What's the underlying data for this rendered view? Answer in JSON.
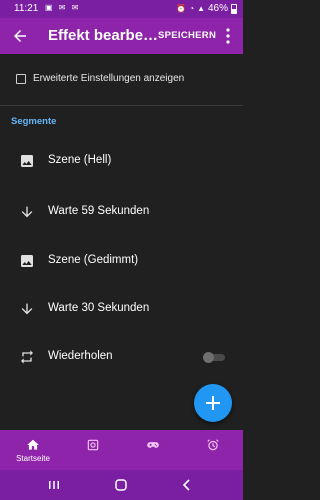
{
  "status_bar": {
    "time": "11:21",
    "left_icons": [
      "gallery-icon",
      "notification-icon",
      "notification-icon"
    ],
    "battery_percent": "46%"
  },
  "app_bar": {
    "title": "Effekt bearbe…",
    "save_label": "SPEICHERN"
  },
  "settings": {
    "advanced_label": "Erweiterte Einstellungen anzeigen",
    "advanced_checked": false
  },
  "segments_header": "Segmente",
  "segments": [
    {
      "icon": "image-icon",
      "label": "Szene (Hell)"
    },
    {
      "icon": "arrow-down-icon",
      "label": "Warte 59 Sekunden"
    },
    {
      "icon": "image-icon",
      "label": "Szene (Gedimmt)"
    },
    {
      "icon": "arrow-down-icon",
      "label": "Warte 30 Sekunden"
    },
    {
      "icon": "repeat-icon",
      "label": "Wiederholen",
      "toggle": false
    }
  ],
  "bottom_nav": {
    "items": [
      {
        "icon": "home-icon",
        "label": "Startseite",
        "active": true
      },
      {
        "icon": "device-icon",
        "label": ""
      },
      {
        "icon": "gamepad-icon",
        "label": ""
      },
      {
        "icon": "alarm-icon",
        "label": ""
      }
    ]
  },
  "colors": {
    "status_bar": "#7b1fa2",
    "app_bar": "#8e24aa",
    "background": "#202020",
    "accent": "#64b5f6",
    "fab": "#2196f3"
  }
}
